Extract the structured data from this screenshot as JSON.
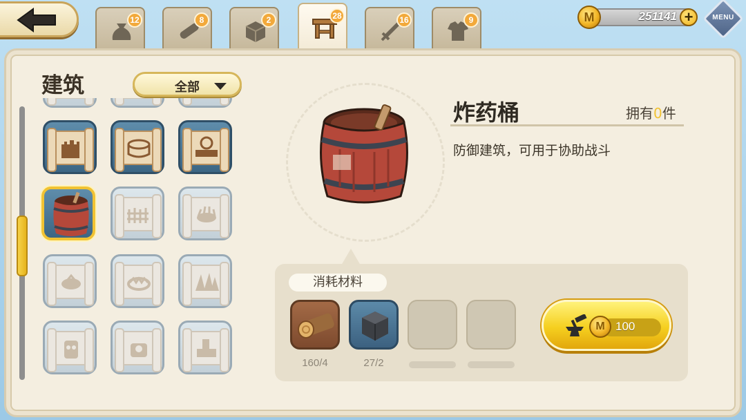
{
  "top_bar": {
    "back_icon": "back-arrow-icon",
    "tabs": [
      {
        "icon": "bag-icon",
        "count": "12"
      },
      {
        "icon": "log-icon",
        "count": "8"
      },
      {
        "icon": "block-icon",
        "count": "2"
      },
      {
        "icon": "table-icon",
        "count": "28",
        "active": true
      },
      {
        "icon": "sword-icon",
        "count": "16"
      },
      {
        "icon": "armor-icon",
        "count": "9"
      }
    ],
    "currency": {
      "coin_symbol": "M",
      "amount": "251141",
      "plus": "+"
    },
    "menu_label": "MENU"
  },
  "left_panel": {
    "title": "建筑",
    "filter_label": "全部"
  },
  "detail": {
    "item_name": "炸药桶",
    "owned_prefix": "拥有",
    "owned_count": "0",
    "owned_suffix": "件",
    "description": "防御建筑，可用于协助战斗"
  },
  "materials": {
    "label": "消耗材料",
    "items": [
      {
        "icon": "wood-log-icon",
        "count": "160/4"
      },
      {
        "icon": "stone-block-icon",
        "count": "27/2"
      },
      {
        "icon": "",
        "count": ""
      },
      {
        "icon": "",
        "count": ""
      }
    ]
  },
  "craft": {
    "coin_symbol": "M",
    "cost": "100",
    "icon": "anvil-hammer-icon"
  },
  "colors": {
    "accent_gold": "#f1c233",
    "panel": "#f4eee0",
    "sky": "#a9d2ec"
  }
}
